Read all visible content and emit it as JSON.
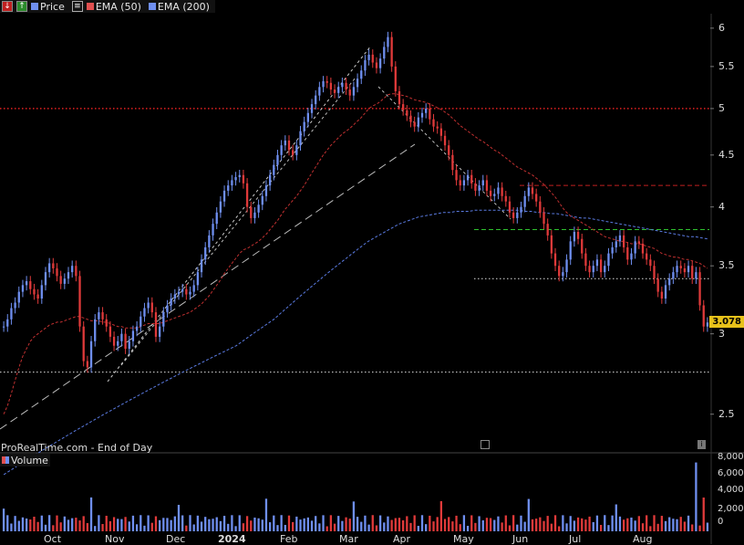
{
  "toolbar": {
    "legend": [
      {
        "label": "Price",
        "color": "#6f8ff0"
      },
      {
        "label": "EMA (50)",
        "color": "#e05050"
      },
      {
        "label": "EMA (200)",
        "color": "#6f8ff0"
      }
    ]
  },
  "credit": "ProRealTime.com - End of Day",
  "volume_label": "Volume",
  "price_badge": "3.078",
  "chart_data": {
    "type": "candlestick",
    "y_scale": "log",
    "ylim": [
      2.3,
      6.2
    ],
    "y_ticks": [
      "6",
      "5.5",
      "5",
      "4.5",
      "4",
      "3.5",
      "3",
      "2.5"
    ],
    "x_ticks": [
      "Oct",
      "Nov",
      "Dec",
      "2024",
      "Feb",
      "Mar",
      "Apr",
      "May",
      "Jun",
      "Jul",
      "Aug"
    ],
    "vol_ticks": [
      "8,000",
      "6,000",
      "4,000",
      "2,000",
      "0"
    ],
    "closes": [
      3.05,
      3.1,
      3.18,
      3.22,
      3.3,
      3.35,
      3.38,
      3.32,
      3.28,
      3.25,
      3.35,
      3.45,
      3.52,
      3.48,
      3.42,
      3.36,
      3.4,
      3.45,
      3.5,
      3.42,
      3.05,
      2.82,
      2.78,
      2.95,
      3.1,
      3.15,
      3.1,
      3.05,
      2.98,
      2.92,
      2.95,
      3.0,
      2.9,
      2.95,
      3.02,
      3.05,
      3.12,
      3.18,
      3.22,
      3.15,
      2.98,
      3.05,
      3.15,
      3.2,
      3.25,
      3.28,
      3.3,
      3.32,
      3.28,
      3.3,
      3.35,
      3.45,
      3.55,
      3.65,
      3.75,
      3.85,
      3.95,
      4.05,
      4.15,
      4.2,
      4.25,
      4.28,
      4.3,
      4.22,
      4.0,
      3.9,
      3.95,
      4.02,
      4.1,
      4.2,
      4.3,
      4.4,
      4.5,
      4.6,
      4.65,
      4.55,
      4.5,
      4.6,
      4.75,
      4.85,
      4.95,
      5.05,
      5.15,
      5.25,
      5.32,
      5.3,
      5.22,
      5.18,
      5.25,
      5.3,
      5.22,
      5.15,
      5.25,
      5.35,
      5.45,
      5.58,
      5.65,
      5.55,
      5.48,
      5.6,
      5.75,
      5.88,
      5.5,
      5.2,
      5.05,
      4.98,
      4.92,
      4.85,
      4.8,
      4.9,
      4.95,
      5.0,
      4.88,
      4.8,
      4.78,
      4.7,
      4.6,
      4.5,
      4.35,
      4.25,
      4.2,
      4.25,
      4.3,
      4.22,
      4.15,
      4.2,
      4.25,
      4.15,
      4.1,
      4.12,
      4.18,
      4.1,
      4.05,
      3.95,
      3.9,
      3.95,
      4.0,
      4.1,
      4.18,
      4.12,
      4.05,
      3.95,
      3.85,
      3.75,
      3.6,
      3.5,
      3.42,
      3.45,
      3.55,
      3.7,
      3.78,
      3.72,
      3.6,
      3.5,
      3.45,
      3.5,
      3.55,
      3.45,
      3.5,
      3.6,
      3.65,
      3.7,
      3.75,
      3.65,
      3.55,
      3.6,
      3.7,
      3.68,
      3.6,
      3.55,
      3.5,
      3.4,
      3.3,
      3.25,
      3.35,
      3.4,
      3.45,
      3.5,
      3.48,
      3.45,
      3.5,
      3.4,
      3.45,
      3.2,
      3.05,
      3.078
    ],
    "ema50": [
      2.5,
      2.55,
      2.62,
      2.7,
      2.78,
      2.85,
      2.9,
      2.95,
      2.98,
      3.0,
      3.02,
      3.04,
      3.06,
      3.07,
      3.08,
      3.08,
      3.09,
      3.1,
      3.11,
      3.12,
      3.12,
      3.11,
      3.1,
      3.09,
      3.09,
      3.09,
      3.08,
      3.08,
      3.07,
      3.06,
      3.05,
      3.05,
      3.04,
      3.04,
      3.04,
      3.04,
      3.05,
      3.06,
      3.07,
      3.07,
      3.07,
      3.07,
      3.08,
      3.09,
      3.1,
      3.11,
      3.12,
      3.13,
      3.14,
      3.15,
      3.17,
      3.19,
      3.21,
      3.24,
      3.27,
      3.31,
      3.35,
      3.39,
      3.44,
      3.48,
      3.52,
      3.56,
      3.6,
      3.63,
      3.64,
      3.66,
      3.68,
      3.7,
      3.73,
      3.76,
      3.8,
      3.84,
      3.88,
      3.93,
      3.98,
      4.02,
      4.06,
      4.1,
      4.15,
      4.2,
      4.26,
      4.32,
      4.38,
      4.44,
      4.5,
      4.55,
      4.6,
      4.64,
      4.68,
      4.72,
      4.75,
      4.78,
      4.82,
      4.86,
      4.9,
      4.95,
      5.0,
      5.03,
      5.05,
      5.08,
      5.12,
      5.16,
      5.17,
      5.17,
      5.16,
      5.15,
      5.14,
      5.12,
      5.1,
      5.09,
      5.08,
      5.07,
      5.05,
      5.03,
      5.01,
      4.99,
      4.96,
      4.93,
      4.89,
      4.85,
      4.81,
      4.78,
      4.75,
      4.72,
      4.69,
      4.66,
      4.64,
      4.61,
      4.58,
      4.55,
      4.53,
      4.5,
      4.47,
      4.44,
      4.41,
      4.38,
      4.36,
      4.34,
      4.32,
      4.3,
      4.27,
      4.24,
      4.21,
      4.17,
      4.13,
      4.09,
      4.04,
      3.99,
      3.95,
      3.92,
      3.9,
      3.88,
      3.86,
      3.84,
      3.82,
      3.8,
      3.78,
      3.76,
      3.74,
      3.73,
      3.72,
      3.71,
      3.7,
      3.7,
      3.69,
      3.68,
      3.68,
      3.68,
      3.67,
      3.66,
      3.65,
      3.64,
      3.62,
      3.6,
      3.59,
      3.58,
      3.57,
      3.57,
      3.56,
      3.55,
      3.55,
      3.54,
      3.53,
      3.52,
      3.5,
      3.48
    ],
    "ema200": [
      2.18,
      2.2,
      2.22,
      2.24,
      2.26,
      2.28,
      2.3,
      2.32,
      2.34,
      2.36,
      2.38,
      2.4,
      2.42,
      2.44,
      2.46,
      2.48,
      2.5,
      2.52,
      2.54,
      2.56,
      2.58,
      2.6,
      2.62,
      2.64,
      2.66,
      2.68,
      2.7,
      2.72,
      2.74,
      2.76,
      2.78,
      2.8,
      2.82,
      2.84,
      2.86,
      2.88,
      2.9,
      2.92,
      2.95,
      2.98,
      3.01,
      3.04,
      3.07,
      3.1,
      3.14,
      3.18,
      3.22,
      3.26,
      3.3,
      3.34,
      3.38,
      3.42,
      3.46,
      3.5,
      3.54,
      3.58,
      3.62,
      3.66,
      3.7,
      3.73,
      3.76,
      3.79,
      3.82,
      3.85,
      3.87,
      3.89,
      3.91,
      3.92,
      3.93,
      3.94,
      3.95,
      3.95,
      3.96,
      3.96,
      3.96,
      3.97,
      3.97,
      3.97,
      3.97,
      3.97,
      3.97,
      3.97,
      3.97,
      3.96,
      3.96,
      3.95,
      3.95,
      3.94,
      3.94,
      3.93,
      3.92,
      3.91,
      3.9,
      3.9,
      3.89,
      3.88,
      3.87,
      3.86,
      3.85,
      3.84,
      3.83,
      3.82,
      3.81,
      3.8,
      3.79,
      3.78,
      3.77,
      3.76,
      3.75,
      3.74,
      3.74,
      3.73,
      3.72
    ],
    "horizontal_lines": [
      {
        "value": 5.0,
        "color": "#e02020",
        "style": "dotted"
      },
      {
        "value": 4.2,
        "color": "#c02020",
        "style": "dashed"
      },
      {
        "value": 3.8,
        "color": "#2ec02e",
        "style": "dashed"
      },
      {
        "value": 3.4,
        "color": "#dddddd",
        "style": "dotted"
      },
      {
        "value": 2.75,
        "color": "#dddddd",
        "style": "dotted"
      }
    ]
  }
}
